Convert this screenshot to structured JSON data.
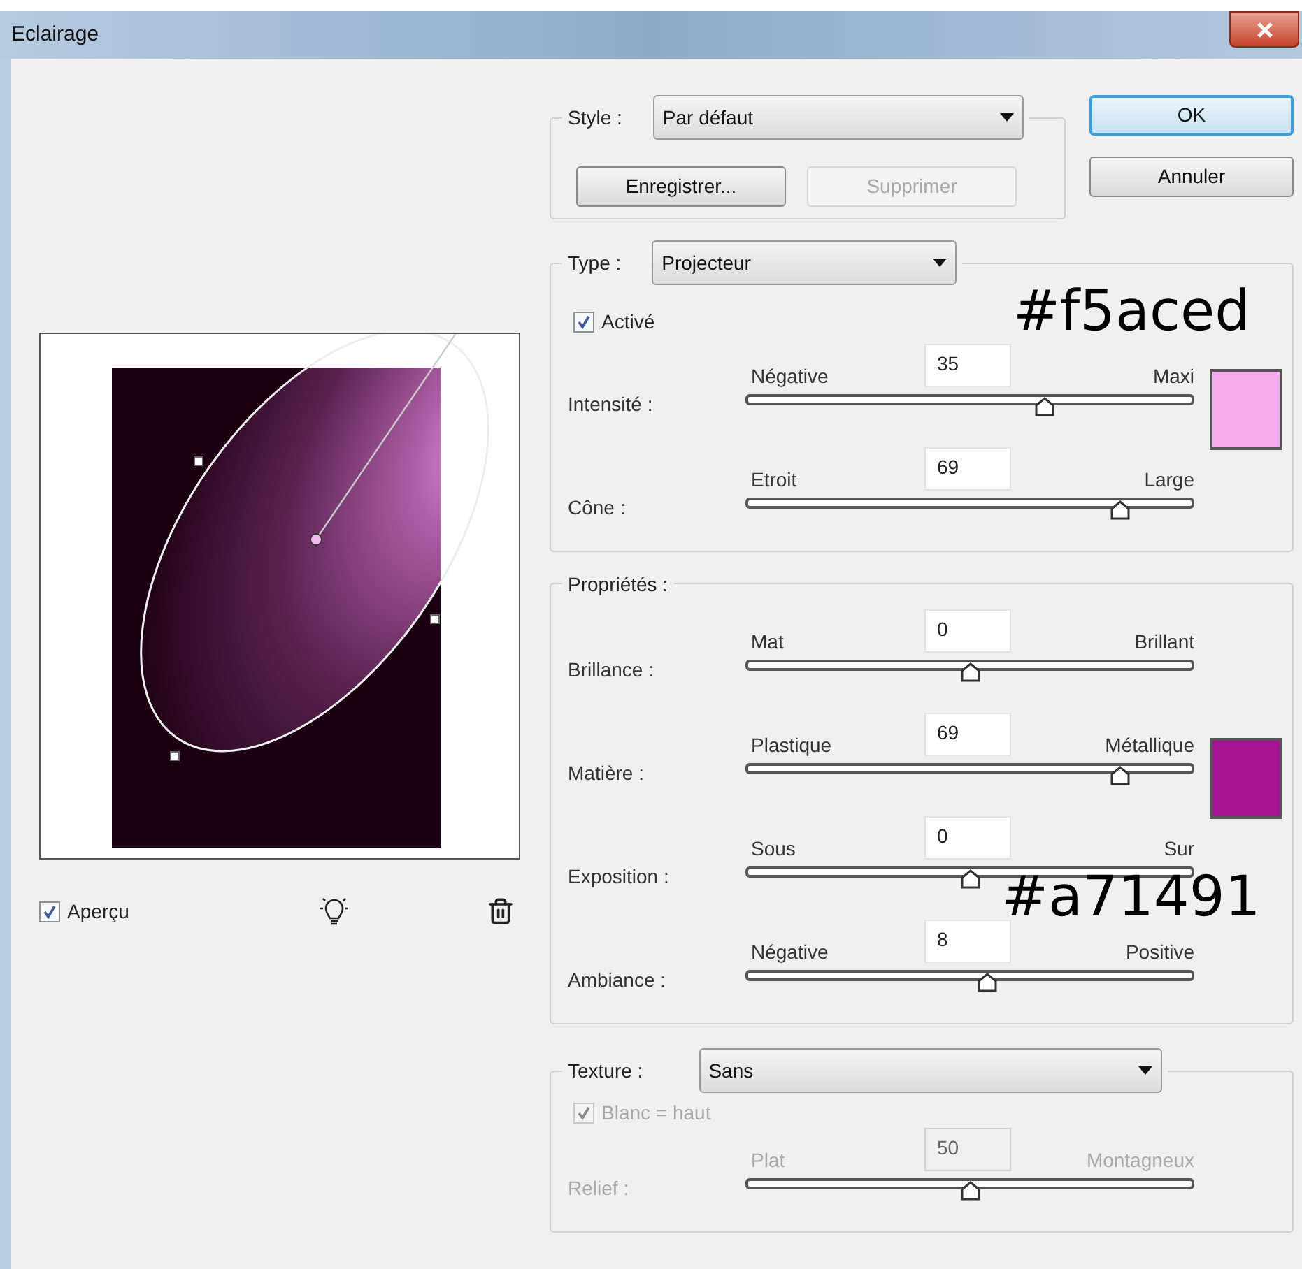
{
  "window": {
    "title": "Eclairage"
  },
  "preview": {
    "checkbox": {
      "label": "Aperçu",
      "checked": true,
      "disabled": false
    }
  },
  "style_group": {
    "label": "Style :",
    "dropdown": "Par défaut",
    "buttons": [
      {
        "label": "Enregistrer...",
        "disabled": false
      },
      {
        "label": "Supprimer",
        "disabled": true
      }
    ]
  },
  "dialog_buttons": [
    {
      "label": "OK",
      "default": true
    },
    {
      "label": "Annuler",
      "default": false
    }
  ],
  "type_group": {
    "label": "Type :",
    "dropdown": "Projecteur",
    "checkbox": {
      "label": "Activé",
      "checked": true,
      "disabled": false
    },
    "annotation": "#f5aced",
    "sliders": [
      {
        "label": "Intensité :",
        "min_label": "Négative",
        "max_label": "Maxi",
        "value": "35",
        "level": 0.67,
        "disabled": false,
        "color": "#f5aced"
      },
      {
        "label": "Cône :",
        "min_label": "Etroit",
        "max_label": "Large",
        "value": "69",
        "level": 0.84,
        "disabled": false
      }
    ]
  },
  "properties_group": {
    "label": "Propriétés :",
    "annotation": "#a71491",
    "sliders": [
      {
        "label": "Brillance :",
        "min_label": "Mat",
        "max_label": "Brillant",
        "value": "0",
        "level": 0.5,
        "disabled": false
      },
      {
        "label": "Matière :",
        "min_label": "Plastique",
        "max_label": "Métallique",
        "value": "69",
        "level": 0.84,
        "disabled": false,
        "color": "#a71491"
      },
      {
        "label": "Exposition :",
        "min_label": "Sous",
        "max_label": "Sur",
        "value": "0",
        "level": 0.5,
        "disabled": false
      },
      {
        "label": "Ambiance :",
        "min_label": "Négative",
        "max_label": "Positive",
        "value": "8",
        "level": 0.54,
        "disabled": false
      }
    ]
  },
  "texture_group": {
    "label": "Texture :",
    "dropdown": "Sans",
    "checkbox": {
      "label": "Blanc = haut",
      "checked": true,
      "disabled": true
    },
    "sliders": [
      {
        "label": "Relief :",
        "min_label": "Plat",
        "max_label": "Montagneux",
        "value": "50",
        "level": 0.5,
        "disabled": true
      }
    ]
  }
}
